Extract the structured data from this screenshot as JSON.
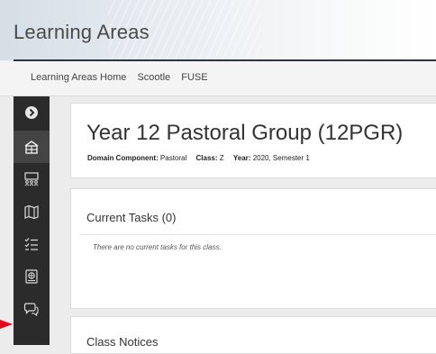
{
  "header": {
    "title": "Learning Areas"
  },
  "nav": {
    "links": [
      "Learning Areas Home",
      "Scootle",
      "FUSE"
    ]
  },
  "sidebar": {
    "icons": [
      "chevron-right-circle-icon",
      "school-icon",
      "classroom-icon",
      "map-icon",
      "checklist-icon",
      "globe-book-icon",
      "chat-icon"
    ],
    "active_index": 1,
    "arrow_color": "#e8001c"
  },
  "course": {
    "title": "Year 12 Pastoral Group (12PGR)",
    "domain_label": "Domain Component:",
    "domain_value": "Pastoral",
    "class_label": "Class:",
    "class_value": "Z",
    "year_label": "Year:",
    "year_value": "2020, Semester 1"
  },
  "tasks": {
    "heading": "Current Tasks (0)",
    "empty_text": "There are no current tasks for this class."
  },
  "notices": {
    "heading": "Class Notices"
  }
}
